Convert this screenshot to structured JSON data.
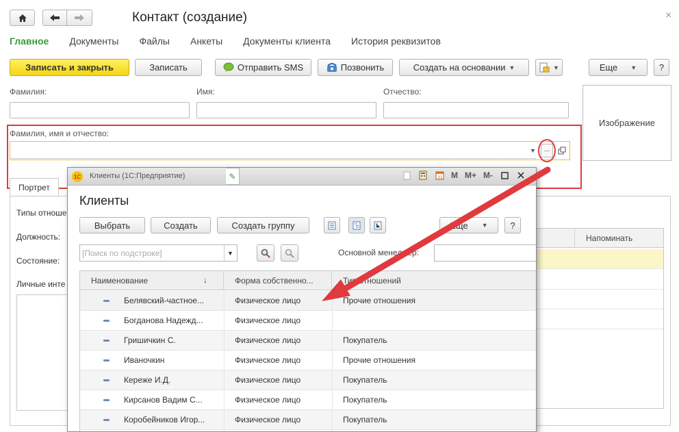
{
  "window": {
    "title": "Контакт (создание)",
    "close_glyph": "×"
  },
  "nav_tabs": [
    {
      "label": "Главное",
      "active": true
    },
    {
      "label": "Документы"
    },
    {
      "label": "Файлы"
    },
    {
      "label": "Анкеты"
    },
    {
      "label": "Документы клиента"
    },
    {
      "label": "История реквизитов"
    }
  ],
  "toolbar": {
    "save_close": "Записать и закрыть",
    "save": "Записать",
    "send_sms": "Отправить SMS",
    "call": "Позвонить",
    "create_based": "Создать на основании",
    "more": "Еще",
    "help": "?"
  },
  "form": {
    "last_name_label": "Фамилия:",
    "first_name_label": "Имя:",
    "middle_name_label": "Отчество:",
    "full_name_label": "Фамилия, имя и отчество:",
    "image_label": "Изображение",
    "ellipsis": "...",
    "tab_portrait": "Портрет",
    "relation_types_label": "Типы отноше",
    "position_label": "Должность:",
    "state_label": "Состояние:",
    "interests_label": "Личные инте",
    "remind_col": "Напоминать"
  },
  "popup": {
    "title_bar": "Клиенты (1С:Предприятие)",
    "logo_text": "1С",
    "tool_icons": [
      "doc-icon",
      "calculator-icon",
      "calendar-icon"
    ],
    "memory_buttons": [
      "M",
      "M+",
      "M-"
    ],
    "heading": "Клиенты",
    "select_btn": "Выбрать",
    "create_btn": "Создать",
    "create_group_btn": "Создать группу",
    "more_btn": "Еще",
    "help_btn": "?",
    "search_placeholder": "[Поиск по подстроке]",
    "manager_label": "Основной менеджер:",
    "columns": [
      "Наименование",
      "Форма собственно...",
      "Тип отношений"
    ],
    "sort_glyph": "↓",
    "rows": [
      {
        "name": "Белявский-частное...",
        "form": "Физическое лицо",
        "relation": "Прочие отношения"
      },
      {
        "name": "Богданова Надежд...",
        "form": "Физическое лицо",
        "relation": ""
      },
      {
        "name": "Гришичкин С.",
        "form": "Физическое лицо",
        "relation": "Покупатель"
      },
      {
        "name": "Иваночкин",
        "form": "Физическое лицо",
        "relation": "Прочие отношения"
      },
      {
        "name": "Кереже И.Д.",
        "form": "Физическое лицо",
        "relation": "Покупатель"
      },
      {
        "name": "Кирсанов Вадим С...",
        "form": "Физическое лицо",
        "relation": "Покупатель"
      },
      {
        "name": "Коробейников Игор...",
        "form": "Физическое лицо",
        "relation": "Покупатель"
      }
    ]
  },
  "colors": {
    "accent_green": "#3b9a3b",
    "primary_yellow": "#f5d511",
    "annotation_red": "#e0393e"
  }
}
